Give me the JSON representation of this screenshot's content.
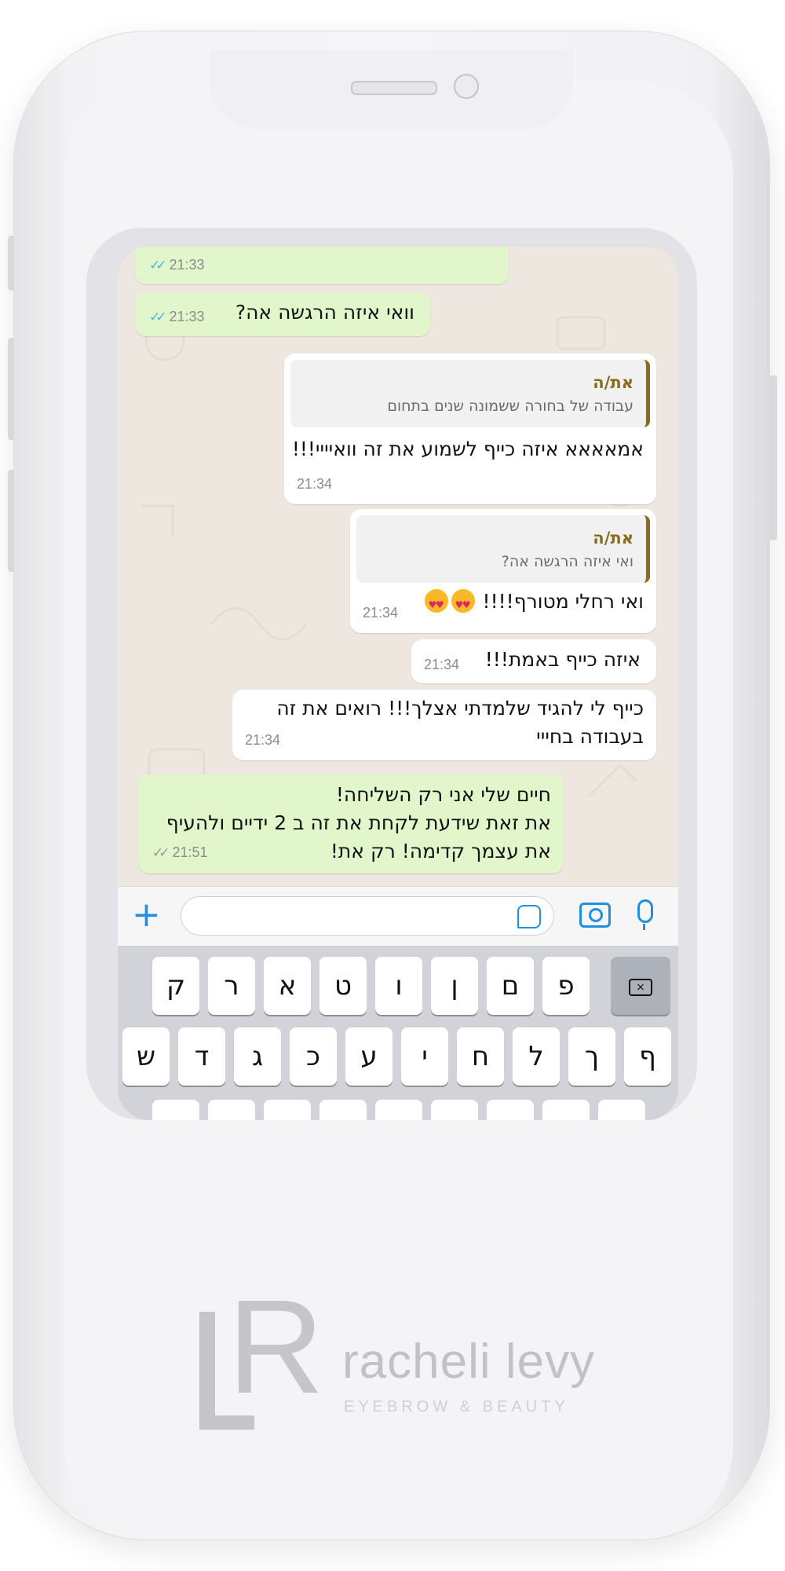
{
  "colors": {
    "outgoing_bubble": "#e1f7cb",
    "incoming_bubble": "#ffffff",
    "quote_accent": "#8a6d1c",
    "read_ticks": "#4fb3e8",
    "ios_blue": "#1f8fe0"
  },
  "messages": [
    {
      "direction": "outgoing",
      "text": "",
      "time": "21:33",
      "status": "read"
    },
    {
      "direction": "outgoing",
      "text": "וואי איזה הרגשה אה?",
      "time": "21:33",
      "status": "read"
    },
    {
      "direction": "incoming",
      "quote": {
        "author": "את/ה",
        "text": "עבודה של בחורה ששמונה שנים בתחום"
      },
      "text": "אמאאאא איזה כייף לשמוע את זה וואיייי!!!",
      "time": "21:34"
    },
    {
      "direction": "incoming",
      "quote": {
        "author": "את/ה",
        "text": "ואי איזה הרגשה אה?"
      },
      "text": "ואי רחלי מטורף!!!!",
      "emoji": [
        "heart-eyes-emoji",
        "heart-eyes-emoji"
      ],
      "time": "21:34"
    },
    {
      "direction": "incoming",
      "text": "איזה כייף באמת!!!",
      "time": "21:34"
    },
    {
      "direction": "incoming",
      "lines": [
        "כייף לי להגיד שלמדתי אצלך!!! רואים את זה",
        "בעבודה בחייי"
      ],
      "time": "21:34"
    },
    {
      "direction": "outgoing",
      "lines": [
        "חיים שלי אני רק השליחה!",
        "את זאת שידעת לקחת את זה ב 2 ידיים ולהעיף",
        "את עצמך קדימה! רק את!"
      ],
      "time": "21:51",
      "status": "read"
    }
  ],
  "input_bar": {
    "placeholder": ""
  },
  "keyboard": {
    "row1": [
      "פ",
      "ם",
      "ן",
      "ו",
      "ט",
      "א",
      "ר",
      "ק"
    ],
    "row2": [
      "ף",
      "ך",
      "ל",
      "ח",
      "י",
      "ע",
      "כ",
      "ג",
      "ד",
      "ש"
    ]
  },
  "brand": {
    "monogram_r": "R",
    "monogram_l": "L",
    "name": "racheli levy",
    "tagline": "EYEBROW & BEAUTY"
  }
}
